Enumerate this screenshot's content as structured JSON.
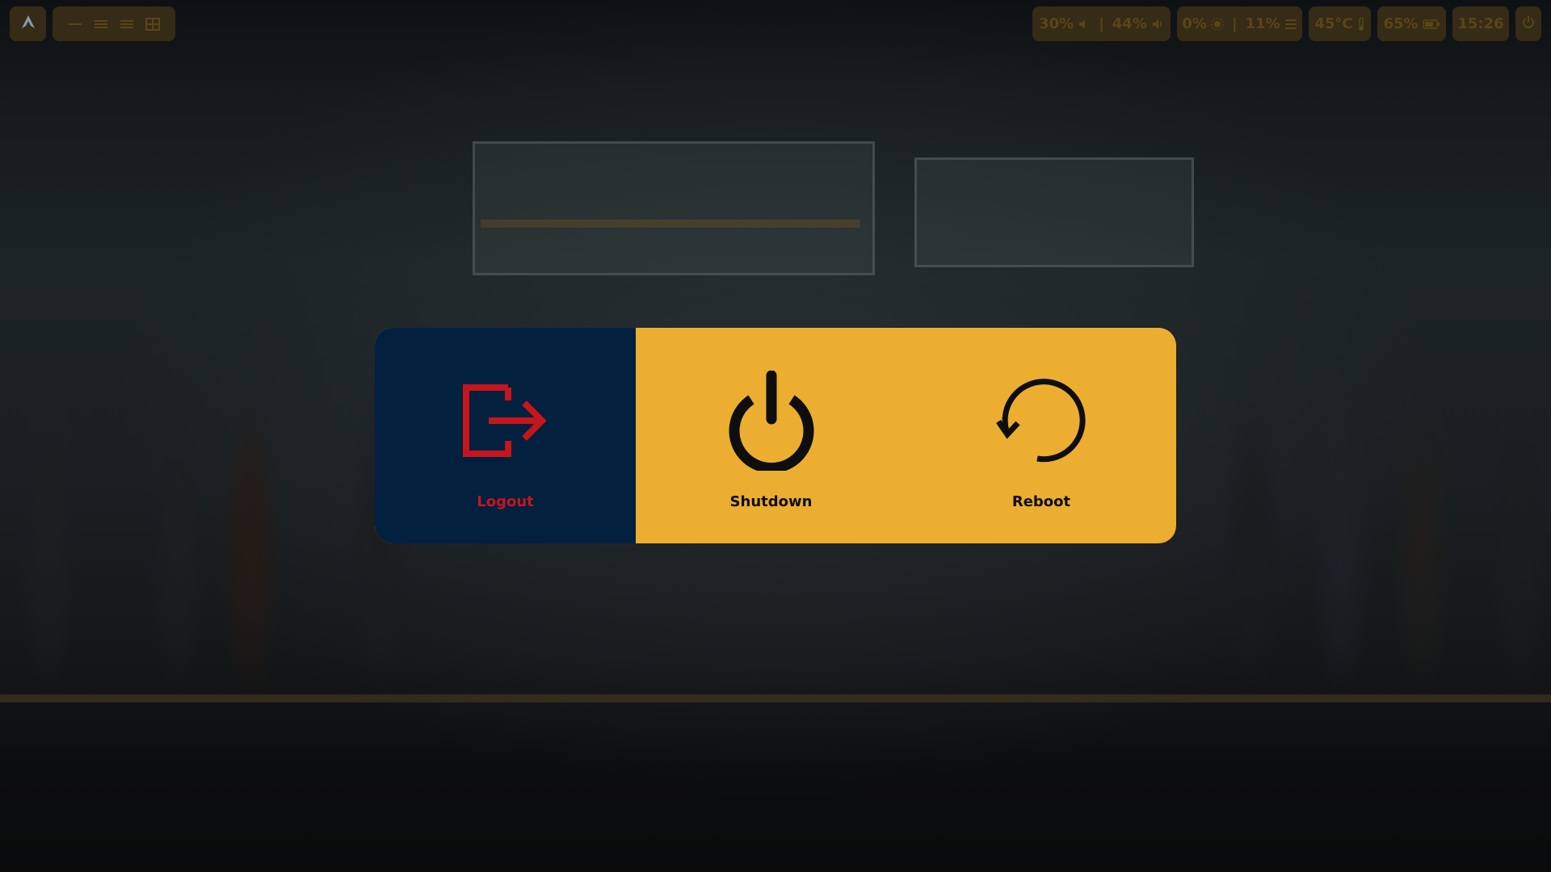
{
  "wallpaper": {
    "description_icon": "train-platform-wallpaper"
  },
  "topbar": {
    "launcher_icon": "arch-logo-icon",
    "workspaces": [
      {
        "icon": "workspace-1-icon",
        "glyph": "—"
      },
      {
        "icon": "workspace-2-icon",
        "glyph": "☰"
      },
      {
        "icon": "workspace-3-icon",
        "glyph": "☰"
      },
      {
        "icon": "workspace-4-icon",
        "glyph": "▦"
      }
    ],
    "volume_output": "30%",
    "volume_input": "44%",
    "brightness": "0%",
    "cpu": "11%",
    "temperature": "45°C",
    "battery": "65%",
    "clock": "15:26",
    "power_icon": "power-icon"
  },
  "power_menu": {
    "items": [
      {
        "label": "Logout",
        "icon": "logout-icon",
        "color": "#c4161c",
        "background": "#03203f"
      },
      {
        "label": "Shutdown",
        "icon": "power-icon",
        "color": "#0e0e0e",
        "background": "#ebae30"
      },
      {
        "label": "Reboot",
        "icon": "reboot-icon",
        "color": "#0e0e0e",
        "background": "#ebae30"
      }
    ]
  },
  "colors": {
    "accent": "#ebae30",
    "selected_bg": "#03203f",
    "selected_fg": "#c4161c",
    "pill_bg": "#3c3016",
    "pill_fg": "#5a4518"
  }
}
